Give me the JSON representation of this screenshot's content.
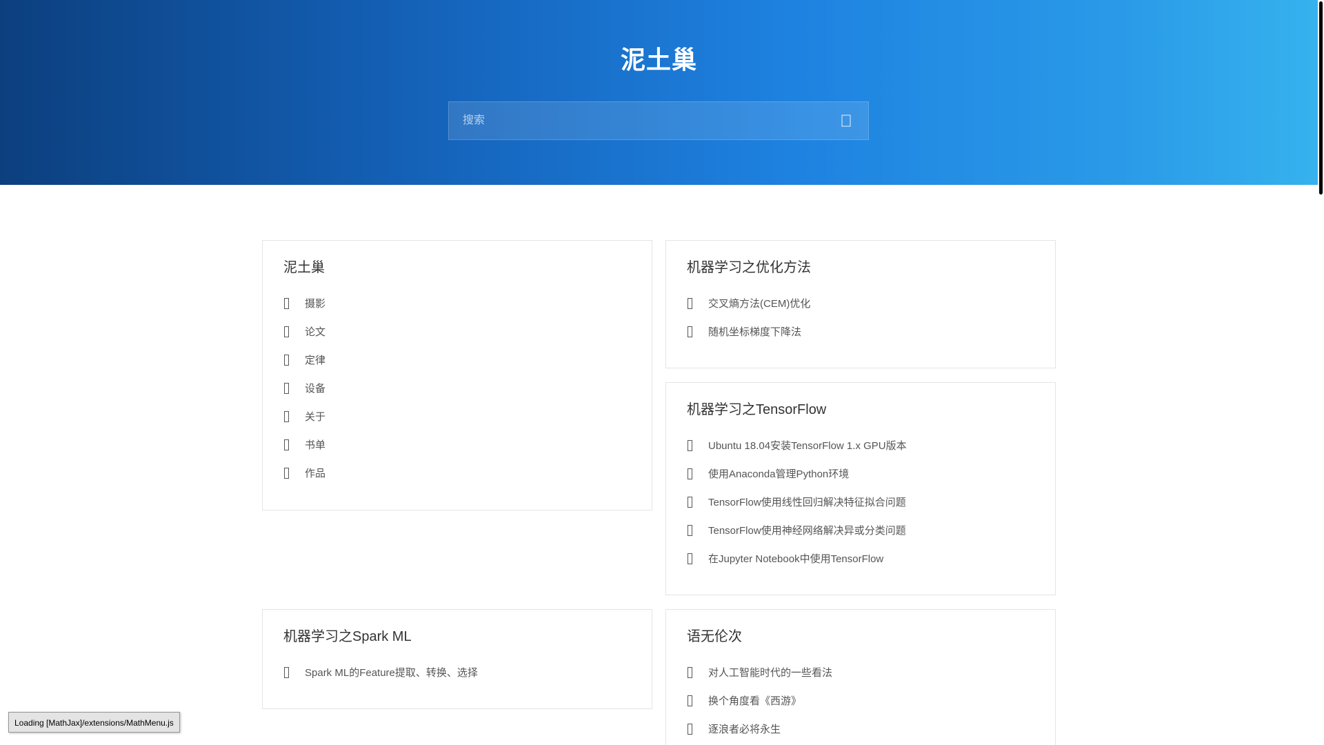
{
  "header": {
    "site_title": "泥土巢",
    "search_placeholder": "搜索"
  },
  "cards": [
    {
      "title": "泥土巢",
      "items": [
        "摄影",
        "论文",
        "定律",
        "设备",
        "关于",
        "书单",
        "作品"
      ]
    },
    {
      "title": "机器学习之优化方法",
      "items": [
        "交叉熵方法(CEM)优化",
        "随机坐标梯度下降法"
      ]
    },
    {
      "title": "机器学习之TensorFlow",
      "items": [
        "Ubuntu 18.04安装TensorFlow 1.x GPU版本",
        "使用Anaconda管理Python环境",
        "TensorFlow使用线性回归解决特征拟合问题",
        "TensorFlow使用神经网络解决异或分类问题",
        "在Jupyter Notebook中使用TensorFlow"
      ]
    },
    {
      "title": "机器学习之Spark ML",
      "items": [
        "Spark ML的Feature提取、转换、选择"
      ]
    },
    {
      "title": "语无伦次",
      "items": [
        "对人工智能时代的一些看法",
        "换个角度看《西游》",
        "逐浪者必将永生"
      ]
    }
  ],
  "status": {
    "loading_text": "Loading [MathJax]/extensions/MathMenu.js"
  },
  "colors": {
    "hero_gradient_start": "#0c3f7e",
    "hero_gradient_end": "#36b2ee",
    "text": "#333333",
    "link": "#555555",
    "card_border": "#e4e4e4"
  }
}
